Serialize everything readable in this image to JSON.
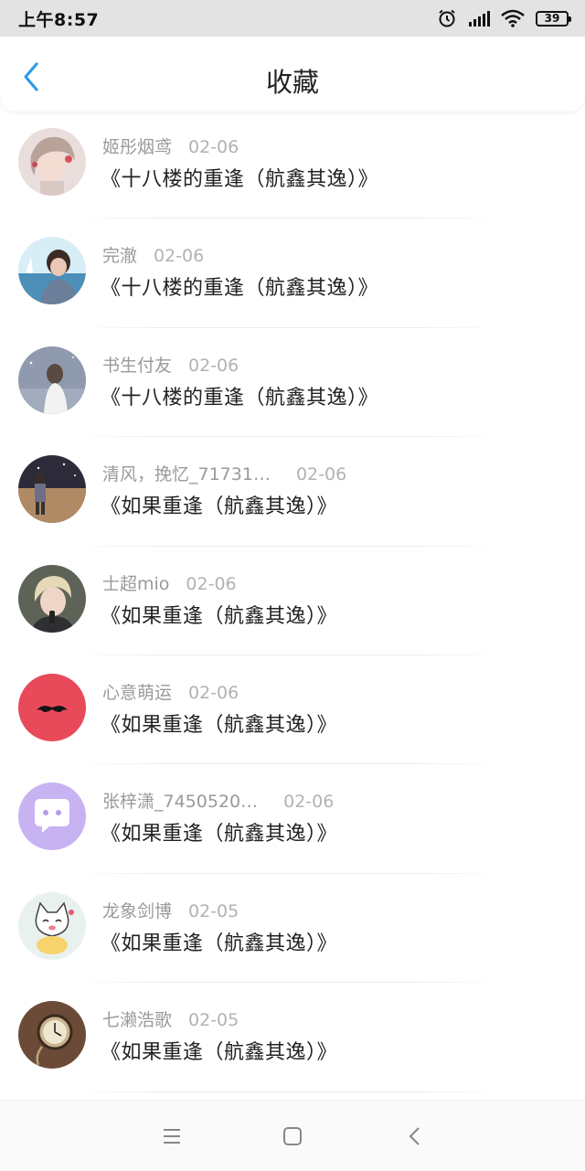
{
  "status_bar": {
    "time": "上午8:57",
    "battery": "39"
  },
  "header": {
    "title": "收藏"
  },
  "favorites": [
    {
      "user": "姬彤烟鸢",
      "date": "02-06",
      "title": "《十八楼的重逢（航鑫其逸）》",
      "avatar": "girl-portrait"
    },
    {
      "user": "完澈",
      "date": "02-06",
      "title": "《十八楼的重逢（航鑫其逸）》",
      "avatar": "boy-by-sea"
    },
    {
      "user": "书生付友",
      "date": "02-06",
      "title": "《十八楼的重逢（航鑫其逸）》",
      "avatar": "girl-illustration"
    },
    {
      "user": "清风，挽忆_71731…",
      "date": "02-06",
      "title": "《如果重逢（航鑫其逸）》",
      "avatar": "person-field"
    },
    {
      "user": "士超mio",
      "date": "02-06",
      "title": "《如果重逢（航鑫其逸）》",
      "avatar": "singer-mic"
    },
    {
      "user": "心意萌运",
      "date": "02-06",
      "title": "《如果重逢（航鑫其逸）》",
      "avatar": "mustache"
    },
    {
      "user": "张梓潇_7450520…",
      "date": "02-06",
      "title": "《如果重逢（航鑫其逸）》",
      "avatar": "chat-bubble"
    },
    {
      "user": "龙象剑博",
      "date": "02-05",
      "title": "《如果重逢（航鑫其逸）》",
      "avatar": "cartoon-cat"
    },
    {
      "user": "七濑浩歌",
      "date": "02-05",
      "title": "《如果重逢（航鑫其逸）》",
      "avatar": "pocket-watch"
    }
  ],
  "colors": {
    "accent": "#2e9be6",
    "mustache_bg": "#e84a5a",
    "chat_bg": "#c7b2f2"
  },
  "nav": {
    "icons": [
      "menu-icon",
      "home-icon",
      "back-icon"
    ]
  }
}
